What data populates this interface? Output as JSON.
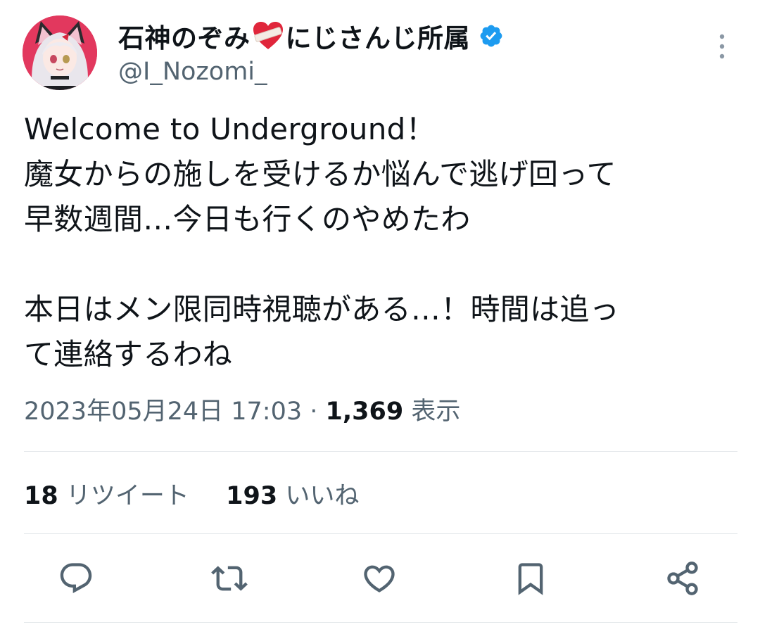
{
  "author": {
    "display_name_part1": "石神のぞみ",
    "display_name_part2": "にじさんじ所属",
    "handle": "@I_Nozomi_",
    "verified": true
  },
  "tweet": {
    "text": "Welcome to Underground！\n魔女からの施しを受けるか悩んで逃げ回って\n早数週間…今日も行くのやめたわ\n\n本日はメン限同時視聴がある…！時間は追っ\nて連絡するわね",
    "timestamp": "2023年05月24日 17:03",
    "separator": " · ",
    "views_count": "1,369",
    "views_label": "表示"
  },
  "stats": {
    "retweets_count": "18",
    "retweets_label": "リツイート",
    "likes_count": "193",
    "likes_label": "いいね"
  },
  "icons": {
    "more": "more-vertical-icon",
    "reply": "reply-icon",
    "retweet": "retweet-icon",
    "like": "heart-icon",
    "bookmark": "bookmark-icon",
    "share": "share-icon"
  },
  "colors": {
    "text": "#0f1419",
    "secondary": "#536471",
    "verified": "#1d9bf0",
    "divider": "#e3e7ea"
  }
}
